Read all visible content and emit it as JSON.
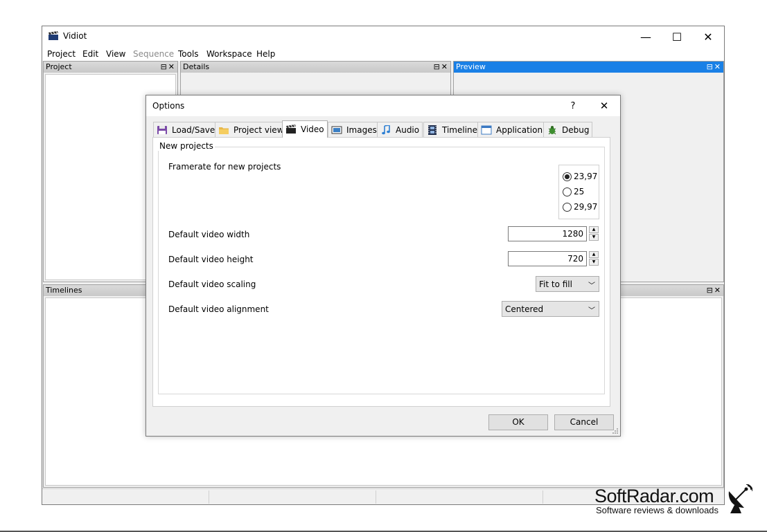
{
  "window": {
    "title": "Vidiot",
    "controls": {
      "minimize": "—",
      "maximize": "☐",
      "close": "✕"
    }
  },
  "menu": [
    "Project",
    "Edit",
    "View",
    "Sequence",
    "Tools",
    "Workspace",
    "Help"
  ],
  "panes": {
    "project": "Project",
    "details": "Details",
    "preview": "Preview",
    "timelines": "Timelines",
    "controls": "⊟✕"
  },
  "dialog": {
    "title": "Options",
    "help": "?",
    "close": "✕",
    "tabs": [
      {
        "label": "Load/Save",
        "icon": "floppy-icon"
      },
      {
        "label": "Project view",
        "icon": "folder-icon"
      },
      {
        "label": "Video",
        "icon": "clapperboard-icon"
      },
      {
        "label": "Images",
        "icon": "image-icon"
      },
      {
        "label": "Audio",
        "icon": "music-note-icon"
      },
      {
        "label": "Timeline",
        "icon": "film-strip-icon"
      },
      {
        "label": "Application",
        "icon": "window-icon"
      },
      {
        "label": "Debug",
        "icon": "bug-icon"
      }
    ],
    "active_tab": "Video",
    "group": "New projects",
    "framerate": {
      "label": "Framerate for new projects",
      "options": [
        "23,97",
        "25",
        "29,97"
      ],
      "selected": "23,97"
    },
    "width": {
      "label": "Default video width",
      "value": "1280"
    },
    "height": {
      "label": "Default video height",
      "value": "720"
    },
    "scaling": {
      "label": "Default video scaling",
      "value": "Fit to fill"
    },
    "alignment": {
      "label": "Default video alignment",
      "value": "Centered"
    },
    "ok": "OK",
    "cancel": "Cancel"
  },
  "watermark": {
    "brand": "SoftRadar.com",
    "tagline": "Software reviews & downloads"
  }
}
